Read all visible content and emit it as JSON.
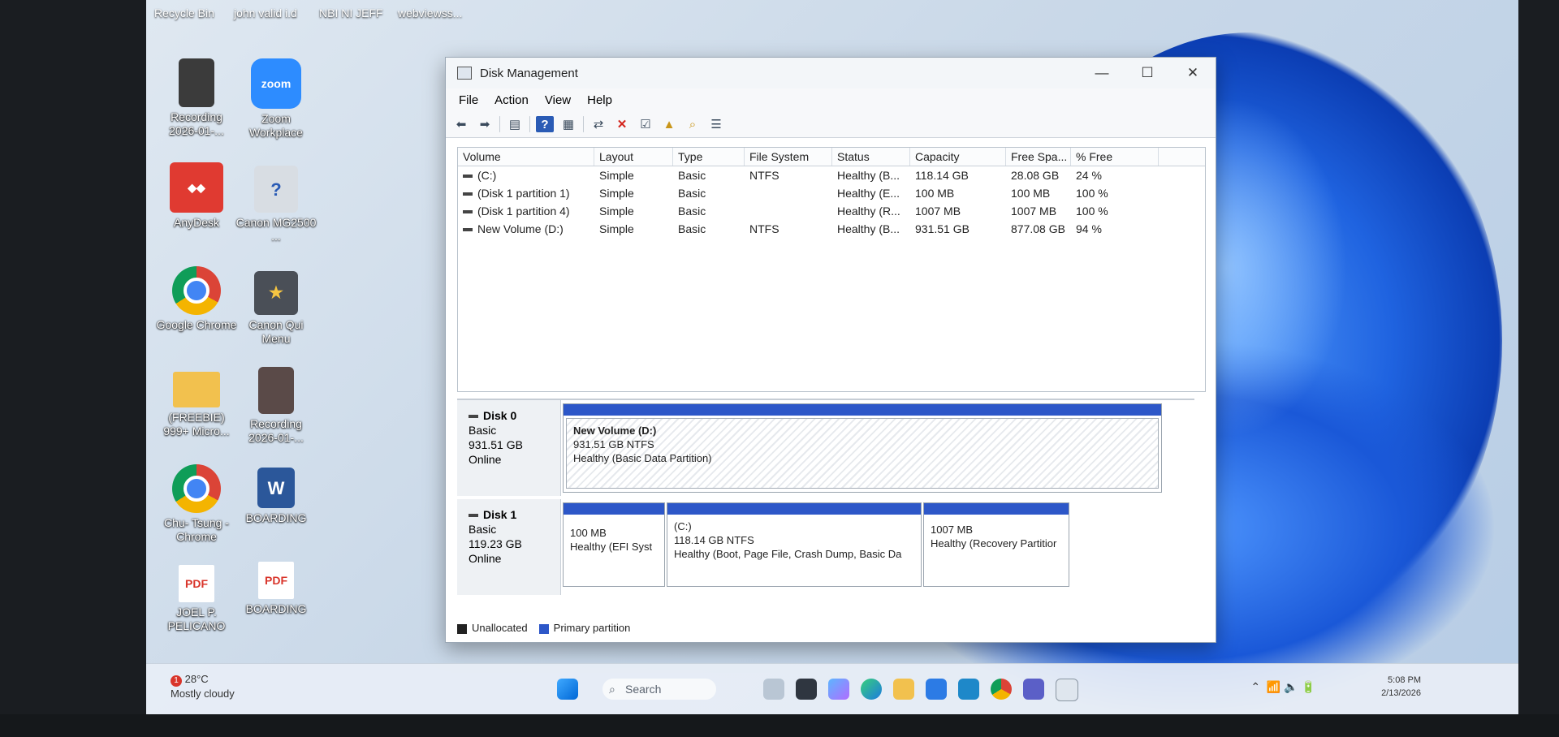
{
  "desktop": {
    "top_labels": [
      "Recycle Bin",
      "john valid i.d",
      "NBI NI JEFF",
      "webviewss..."
    ],
    "icons": [
      {
        "label": "Recording 2026-01-...",
        "icon": "video-thumbnail"
      },
      {
        "label": "Zoom Workplace",
        "icon": "zoom-icon"
      },
      {
        "label": "AnyDesk",
        "icon": "anydesk-icon"
      },
      {
        "label": "Canon MG2500 ...",
        "icon": "printer-help-icon"
      },
      {
        "label": "Google Chrome",
        "icon": "chrome-icon"
      },
      {
        "label": "Canon Qui Menu",
        "icon": "canon-menu-icon"
      },
      {
        "label": "(FREEBIE) 999+ Micro...",
        "icon": "folder-icon"
      },
      {
        "label": "Recording 2026-01-...",
        "icon": "video-thumbnail"
      },
      {
        "label": "Chu- Tsung - Chrome",
        "icon": "chrome-profile-icon"
      },
      {
        "label": "BOARDING",
        "icon": "word-doc-icon"
      },
      {
        "label": "JOEL P. PELICANO",
        "icon": "pdf-icon"
      },
      {
        "label": "BOARDING",
        "icon": "pdf-icon"
      }
    ],
    "zoom_text": "zoom",
    "pdf_text": "PDF"
  },
  "window": {
    "title": "Disk Management",
    "controls": {
      "minimize": "—",
      "maximize": "☐",
      "close": "✕"
    },
    "menu": [
      "File",
      "Action",
      "View",
      "Help"
    ]
  },
  "volume_table": {
    "headers": [
      "Volume",
      "Layout",
      "Type",
      "File System",
      "Status",
      "Capacity",
      "Free Spa...",
      "% Free"
    ],
    "rows": [
      [
        "(C:)",
        "Simple",
        "Basic",
        "NTFS",
        "Healthy (B...",
        "118.14 GB",
        "28.08 GB",
        "24 %"
      ],
      [
        "(Disk 1 partition 1)",
        "Simple",
        "Basic",
        "",
        "Healthy (E...",
        "100 MB",
        "100 MB",
        "100 %"
      ],
      [
        "(Disk 1 partition 4)",
        "Simple",
        "Basic",
        "",
        "Healthy (R...",
        "1007 MB",
        "1007 MB",
        "100 %"
      ],
      [
        "New Volume (D:)",
        "Simple",
        "Basic",
        "NTFS",
        "Healthy (B...",
        "931.51 GB",
        "877.08 GB",
        "94 %"
      ]
    ]
  },
  "disks": [
    {
      "name": "Disk 0",
      "type": "Basic",
      "size": "931.51 GB",
      "state": "Online",
      "partitions": [
        {
          "title": "New Volume  (D:)",
          "size": "931.51 GB NTFS",
          "status": "Healthy (Basic Data Partition)"
        }
      ]
    },
    {
      "name": "Disk 1",
      "type": "Basic",
      "size": "119.23 GB",
      "state": "Online",
      "partitions": [
        {
          "title": "",
          "size": "100 MB",
          "status": "Healthy (EFI Syst"
        },
        {
          "title": "(C:)",
          "size": "118.14 GB NTFS",
          "status": "Healthy (Boot, Page File, Crash Dump, Basic Da"
        },
        {
          "title": "",
          "size": "1007 MB",
          "status": "Healthy (Recovery Partitior"
        }
      ]
    }
  ],
  "legend": {
    "unallocated": "Unallocated",
    "primary": "Primary partition",
    "colors": {
      "unallocated": "#222222",
      "primary": "#2d57c8"
    }
  },
  "taskbar": {
    "weather_temp": "28°C",
    "weather_desc": "Mostly cloudy",
    "weather_badge": "1",
    "search_placeholder": "Search",
    "time": "5:08 PM",
    "date": "2/13/2026"
  }
}
